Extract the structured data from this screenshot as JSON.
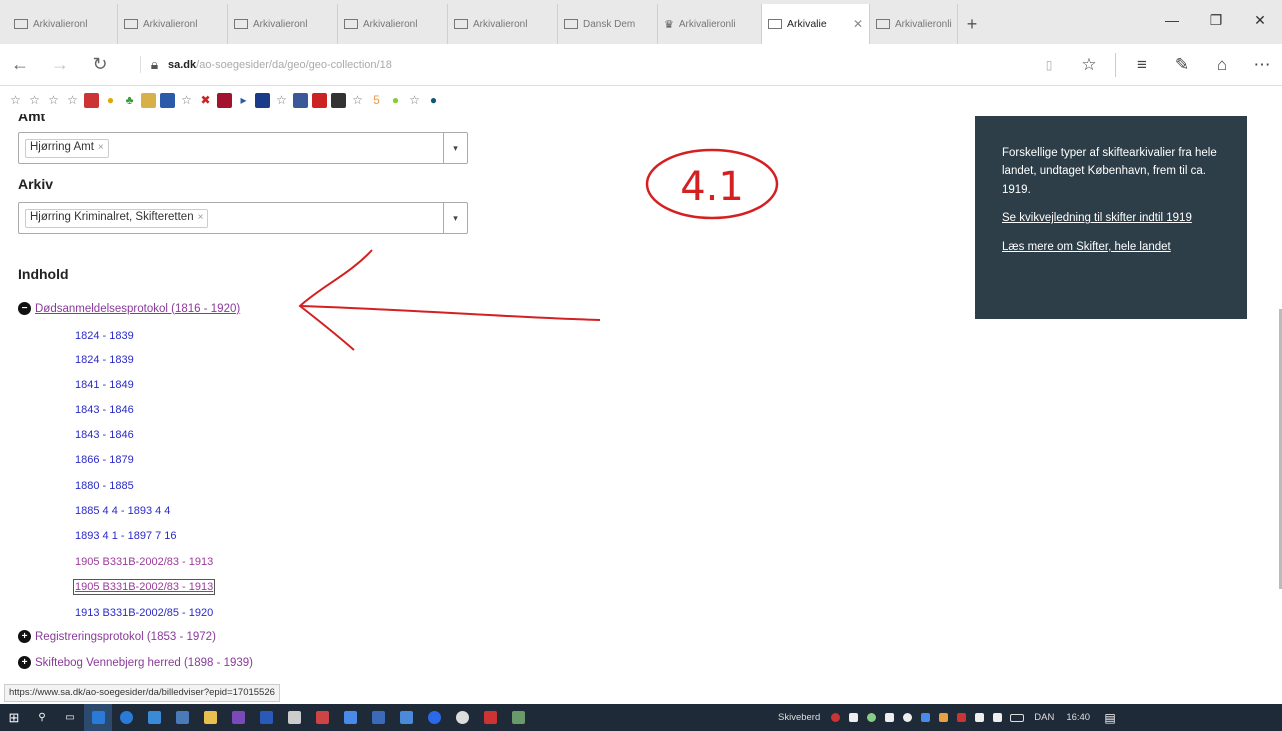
{
  "browser": {
    "tabs": [
      {
        "label": "Arkivalieronl"
      },
      {
        "label": "Arkivalieronl"
      },
      {
        "label": "Arkivalieronl"
      },
      {
        "label": "Arkivalieronl"
      },
      {
        "label": "Arkivalieronl"
      },
      {
        "label": "Dansk Dem"
      },
      {
        "label": "Arkivalieronli"
      },
      {
        "label": "Arkivalie"
      },
      {
        "label": "Arkivalieronli"
      }
    ],
    "url_domain": "sa.dk",
    "url_path": "/ao-soegesider/da/geo/geo-collection/18"
  },
  "form": {
    "amt_label": "Amt",
    "amt_value": "Hjørring Amt",
    "arkiv_label": "Arkiv",
    "arkiv_value": "Hjørring Kriminalret, Skifteretten"
  },
  "content": {
    "heading": "Indhold",
    "expanded_item": "Dødsanmeldelsesprotokol (1816 - 1920)",
    "sub_items": [
      "1824 - 1839",
      "1824 - 1839",
      "1841 - 1849",
      "1843 - 1846",
      "1843 - 1846",
      "1866 - 1879",
      "1880 - 1885",
      "1885 4 4 - 1893 4 4",
      "1893 4 1 - 1897 7 16",
      "1905 B331B-2002/83 - 1913",
      "1905 B331B-2002/83 - 1913",
      "1913 B331B-2002/85 - 1920"
    ],
    "collapsed_items": [
      "Registreringsprotokol (1853 - 1972)",
      "Skiftebog Vennebjerg herred (1898 - 1939)"
    ]
  },
  "infobox": {
    "text": "Forskellige typer af skiftearkivalier fra hele landet, undtaget København, frem til ca. 1919.",
    "link1": "Se kvikvejledning til skifter indtil 1919",
    "link2": "Læs mere om Skifter, hele landet"
  },
  "annotation": {
    "number": "4.1",
    "color": "#d42020"
  },
  "status_url": "https://www.sa.dk/ao-soegesider/da/billedviser?epid=17015526",
  "taskbar": {
    "weather": "Skiveberd",
    "language": "DAN",
    "time": "16:40"
  }
}
